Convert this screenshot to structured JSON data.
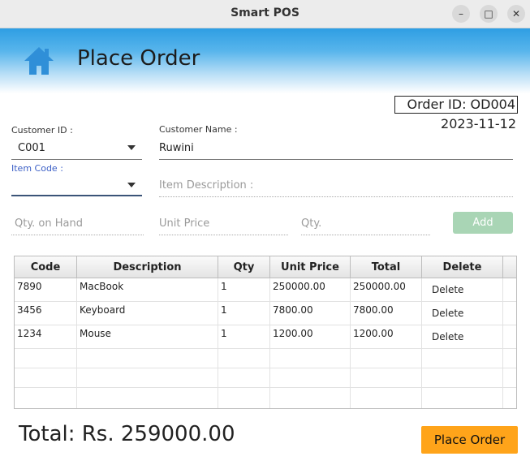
{
  "window": {
    "title": "Smart POS"
  },
  "header": {
    "title": "Place Order"
  },
  "order": {
    "id_text": "Order ID: OD004",
    "date": "2023-11-12"
  },
  "form": {
    "customer_id": {
      "label": "Customer ID :",
      "value": "C001"
    },
    "customer_name": {
      "label": "Customer Name :",
      "value": "Ruwini"
    },
    "item_code": {
      "label": "Item Code :",
      "value": ""
    },
    "item_description": {
      "placeholder": "Item Description :"
    },
    "qty_on_hand": {
      "placeholder": "Qty. on Hand"
    },
    "unit_price": {
      "placeholder": "Unit Price"
    },
    "qty": {
      "placeholder": "Qty."
    },
    "add_label": "Add"
  },
  "table": {
    "columns": [
      "Code",
      "Description",
      "Qty",
      "Unit Price",
      "Total",
      "Delete"
    ],
    "rows": [
      {
        "code": "7890",
        "description": "MacBook",
        "qty": "1",
        "unit_price": "250000.00",
        "total": "250000.00",
        "delete": "Delete"
      },
      {
        "code": "3456",
        "description": "Keyboard",
        "qty": "1",
        "unit_price": "7800.00",
        "total": "7800.00",
        "delete": "Delete"
      },
      {
        "code": "1234",
        "description": "Mouse",
        "qty": "1",
        "unit_price": "1200.00",
        "total": "1200.00",
        "delete": "Delete"
      }
    ]
  },
  "footer": {
    "total_text": "Total: Rs. 259000.00",
    "place_order_label": "Place Order"
  },
  "colors": {
    "accent": "#2e9ee3",
    "place_order": "#ffa41a",
    "add_button": "#a9d5b5"
  }
}
